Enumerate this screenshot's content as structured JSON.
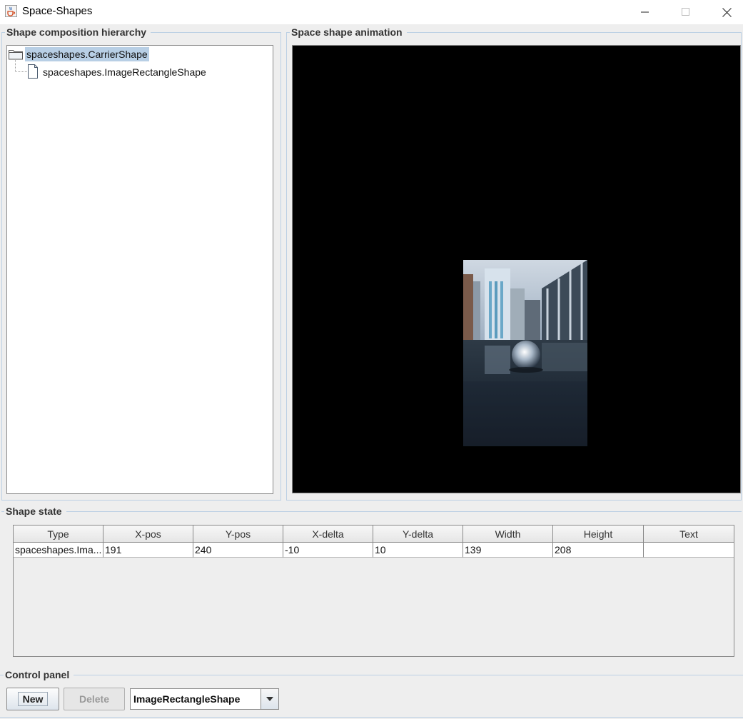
{
  "window": {
    "title": "Space-Shapes",
    "icon": "java-cup-icon",
    "controls": [
      "minimize-icon",
      "maximize-icon",
      "close-icon"
    ]
  },
  "hierarchy": {
    "title": "Shape composition hierarchy",
    "root": {
      "label": "spaceshapes.CarrierShape",
      "icon": "folder-icon",
      "selected": true
    },
    "children": [
      {
        "label": "spaceshapes.ImageRectangleShape",
        "icon": "file-icon"
      }
    ]
  },
  "animation": {
    "title": "Space shape animation",
    "background": "#000000",
    "shape_image": "city-reflection-crystal-ball-photo"
  },
  "state": {
    "title": "Shape state",
    "columns": [
      "Type",
      "X-pos",
      "Y-pos",
      "X-delta",
      "Y-delta",
      "Width",
      "Height",
      "Text"
    ],
    "rows": [
      [
        "spaceshapes.Ima...",
        "191",
        "240",
        "-10",
        "10",
        "139",
        "208",
        ""
      ]
    ]
  },
  "controls": {
    "title": "Control panel",
    "new_label": "New",
    "delete_label": "Delete",
    "shape_type_selected": "ImageRectangleShape"
  },
  "colors": {
    "selection": "#b8cfe5",
    "border_accent": "#bcd0e4",
    "background": "#eeeeee"
  }
}
